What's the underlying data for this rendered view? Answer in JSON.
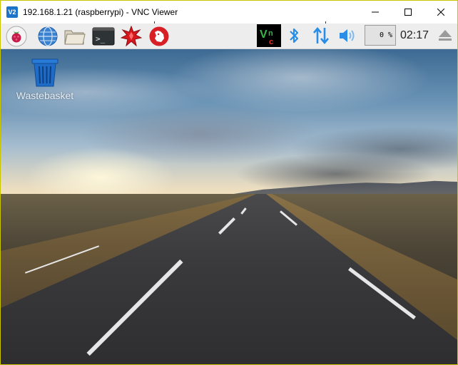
{
  "window": {
    "app_icon_text": "V2",
    "title": "192.168.1.21 (raspberrypi) - VNC Viewer"
  },
  "panel": {
    "launchers": [
      {
        "icon": "raspberry-menu-icon"
      },
      {
        "icon": "web-browser-globe-icon"
      },
      {
        "icon": "file-manager-folder-icon"
      },
      {
        "icon": "terminal-icon",
        "text": ">_"
      },
      {
        "icon": "wolfram-mathematica-icon"
      },
      {
        "icon": "wolfram-icon"
      }
    ],
    "tray": {
      "vnc_icon": "vnc-server-icon",
      "bluetooth_icon": "bluetooth-icon",
      "network_icon": "network-arrows-icon",
      "volume_icon": "volume-icon",
      "cpu_usage": "0 %",
      "clock": "02:17",
      "eject_icon": "eject-icon"
    },
    "colors": {
      "tray_icon_blue": "#2a8ee6",
      "vnc_green": "#3ab54a",
      "vnc_red": "#e8302a"
    }
  },
  "desktop": {
    "icons": [
      {
        "label": "Wastebasket",
        "icon": "wastebasket-icon"
      }
    ]
  }
}
